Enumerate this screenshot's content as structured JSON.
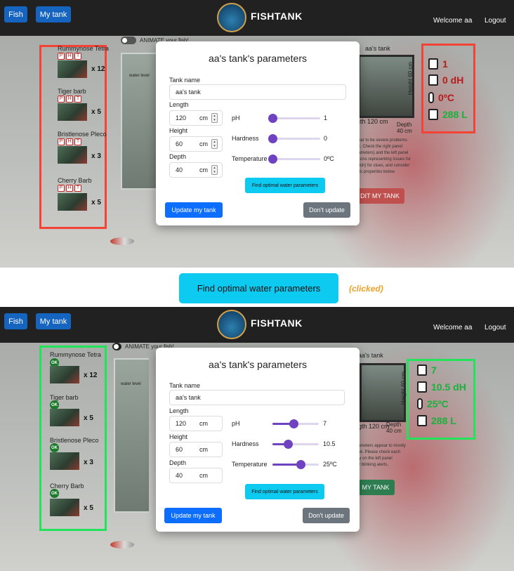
{
  "nav": {
    "fish_label": "Fish",
    "tank_label": "My tank",
    "brand": "FISHTANK",
    "welcome": "Welcome aa",
    "logout": "Logout"
  },
  "animate_label": "ANIMATE your fish!",
  "tank_label": "aa's tank",
  "water_level": "water level",
  "fish": [
    {
      "name": "Rummynose Tetra",
      "count": "x 12"
    },
    {
      "name": "Tiger barb",
      "count": "x 5"
    },
    {
      "name": "Bristlenose Pleco",
      "count": "x 3"
    },
    {
      "name": "Cherry Barb",
      "count": "x 5"
    }
  ],
  "ok_label": "OK",
  "modal": {
    "title": "aa's tank's parameters",
    "tank_name_label": "Tank name",
    "tank_name_value": "aa's tank",
    "length_label": "Length",
    "length_value": "120",
    "height_label": "Height",
    "height_value": "60",
    "depth_label": "Depth",
    "depth_value": "40",
    "unit": "cm",
    "ph_label": "pH",
    "hardness_label": "Hardness",
    "temperature_label": "Temperature",
    "find_label": "Find optimal water parameters",
    "update_label": "Update my tank",
    "dont_update_label": "Don't update"
  },
  "before": {
    "ph": "1",
    "hardness": "0",
    "temperature": "0ºC",
    "ph_level": 0.0,
    "hardness_level": 0.0,
    "temperature_level": 0.0,
    "params": {
      "ph": "1",
      "hardness": "0 dH",
      "temp": "0ºC",
      "volume": "288 L"
    },
    "edit_label": "DIT MY TANK",
    "behind_lines": [
      "ear to be severe problems",
      "k. Check the right panel",
      "ameters) and the left panel",
      "cons representing issues for",
      "fish) for clues, and consider",
      "its properties below."
    ]
  },
  "after": {
    "ph": "7",
    "hardness": "10.5",
    "temperature": "25ºC",
    "ph_level": 0.45,
    "hardness_level": 0.33,
    "temperature_level": 0.6,
    "params": {
      "ph": "7",
      "hardness": "10.5 dH",
      "temp": "25ºC",
      "volume": "288 L"
    },
    "edit_label": "MY TANK",
    "behind_lines": [
      "ameters appear to mostly",
      "ok. Please check each",
      "ly on the left panel",
      "y blinking alerts."
    ]
  },
  "dims": {
    "width": "gth 120 cm",
    "depth": "Depth 40 cm",
    "height": "Height 60 cm"
  },
  "middle": {
    "button": "Find optimal water parameters",
    "note": "(clicked)"
  },
  "colors": {
    "warn": "#f44336",
    "ok": "#23e35b",
    "accent": "#6f42c1",
    "nav": "#212121"
  }
}
